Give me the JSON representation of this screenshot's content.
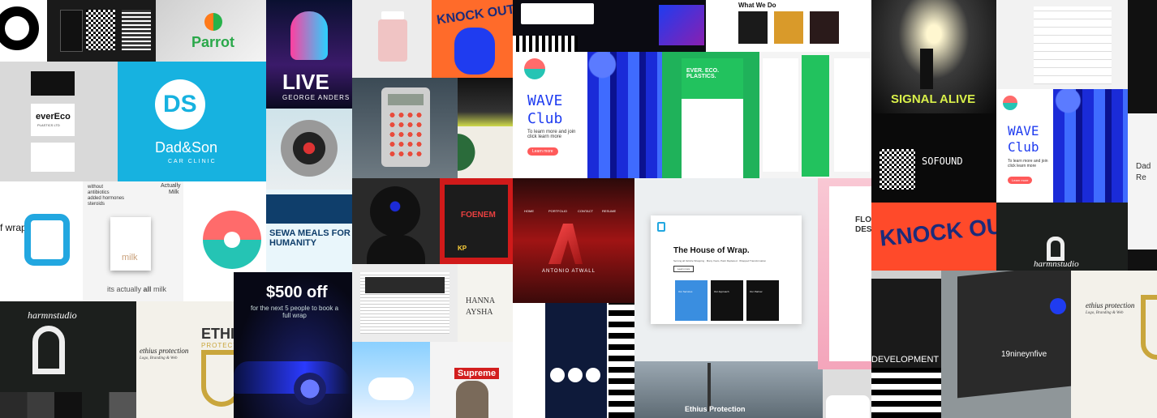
{
  "tiles": {
    "parrot": {
      "logo_text": "Parrot"
    },
    "dadson": {
      "monogram": "DS",
      "name": "Dad&Son",
      "tagline": "CAR CLINIC"
    },
    "evereco": {
      "name": "everEco",
      "tagline": "PLASTICS LTD"
    },
    "live": {
      "headline": "LIVE",
      "subline": "GEORGE ANDERS"
    },
    "knockout": {
      "headline": "KNOCK OUT"
    },
    "wave": {
      "title_line1": "WAVE",
      "title_line2": "Club",
      "body": "To learn more and join click learn more",
      "button": "Learn more"
    },
    "whatwedo": {
      "heading": "What We Do"
    },
    "signal": {
      "headline": "SIGNAL ALIVE"
    },
    "wave2": {
      "title_line1": "WAVE",
      "title_line2": "Club",
      "body": "To learn more and join click learn more",
      "button": "Learn more"
    },
    "milk": {
      "list": [
        "without",
        "antibiotics",
        "added hormones",
        "steroids"
      ],
      "brand": "Actually",
      "brand2": "Milk",
      "carton": "milk",
      "slogan_pre": "its actually ",
      "slogan_bold": "all",
      "slogan_post": " milk"
    },
    "wrap_logo": {
      "text": "f wrap"
    },
    "sewa": {
      "headline": "SEWA MEALS FOR HUMANITY"
    },
    "evergreen": {
      "headline": "EVER. ECO. PLASTICS."
    },
    "hanna": {
      "line1": "HANNA",
      "line2": "AYSHA"
    },
    "atwall": {
      "name": "ANTONIO ATWALL",
      "nav": [
        "HOME",
        "PORTFOLIO",
        "CONTACT",
        "RESUME"
      ]
    },
    "houseofwrap": {
      "title": "The House of Wrap.",
      "tagline": "Serving all Vehicle Wrapping · Many Years, Paint Replaced · Wrapped Transformation",
      "button": "Learn more",
      "cards": [
        "Our Services",
        "Our Approach",
        "Our Partner"
      ]
    },
    "foenem": {
      "headline": "FOENEM",
      "badge": "KP"
    },
    "discount": {
      "headline": "$500 off",
      "sub": "for the next 5 people to book a full wrap"
    },
    "harmn1": {
      "name": "harmnstudio"
    },
    "harmn2": {
      "name": "harmnstudio"
    },
    "ethius1": {
      "word": "ETHIUS",
      "word2": "PROTECTION",
      "sig": "ethius protection",
      "sig2": "Logo, Branding & Web"
    },
    "ethius2": {
      "sig": "ethius protection",
      "sig2": "Logo, Branding & Web"
    },
    "ethius_city": {
      "label": "Ethius Protection"
    },
    "supreme": {
      "label": "Supreme"
    },
    "nineteen": {
      "label": "19nineynfive"
    },
    "development": {
      "label": "DEVELOPMENT"
    },
    "flo": {
      "line1": "FLO",
      "line2": "DESI"
    },
    "dad_right": {
      "line1": "Dad",
      "line2": "Re"
    },
    "qr": {
      "label": "SOFOUND"
    }
  },
  "colors": {
    "cyan": "#17b2e0",
    "green": "#1fb25a",
    "blue": "#1f3cf0",
    "wave_red": "#ff5a5a",
    "wave_teal": "#25c4b4"
  }
}
